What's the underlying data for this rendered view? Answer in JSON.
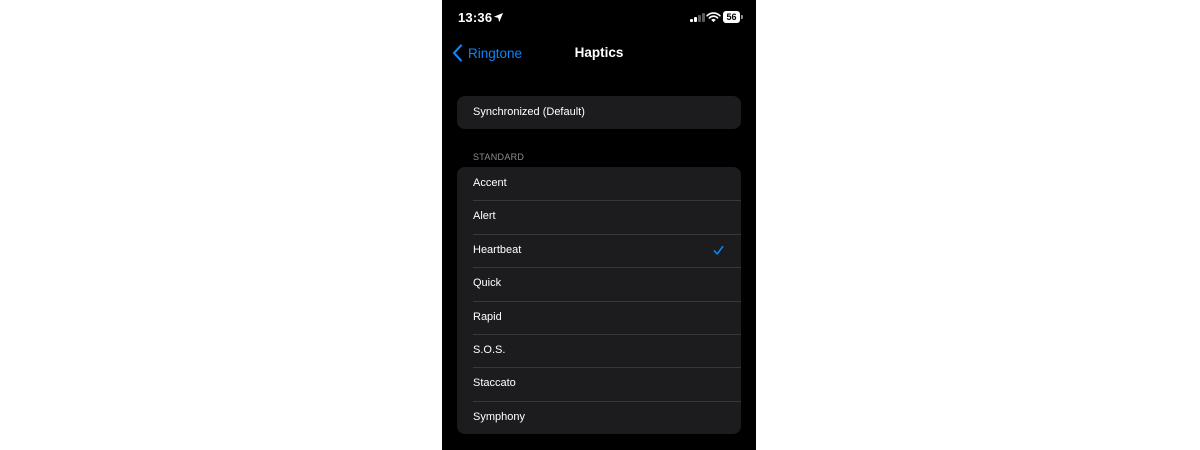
{
  "status_bar": {
    "time": "13:36",
    "battery_level": "56",
    "location_icon": "location-arrow-icon",
    "signal_icon": "cellular-signal-icon",
    "wifi_icon": "wifi-icon"
  },
  "nav": {
    "back_label": "Ringtone",
    "title": "Haptics"
  },
  "default_option": {
    "label": "Synchronized (Default)"
  },
  "standard_section": {
    "header": "STANDARD",
    "items": [
      {
        "label": "Accent",
        "selected": false
      },
      {
        "label": "Alert",
        "selected": false
      },
      {
        "label": "Heartbeat",
        "selected": true
      },
      {
        "label": "Quick",
        "selected": false
      },
      {
        "label": "Rapid",
        "selected": false
      },
      {
        "label": "S.O.S.",
        "selected": false
      },
      {
        "label": "Staccato",
        "selected": false
      },
      {
        "label": "Symphony",
        "selected": false
      }
    ]
  },
  "colors": {
    "background": "#000000",
    "cell": "#1c1c1e",
    "accent": "#0a84ff",
    "separator": "#38383a",
    "secondary_text": "#8e8e93"
  }
}
